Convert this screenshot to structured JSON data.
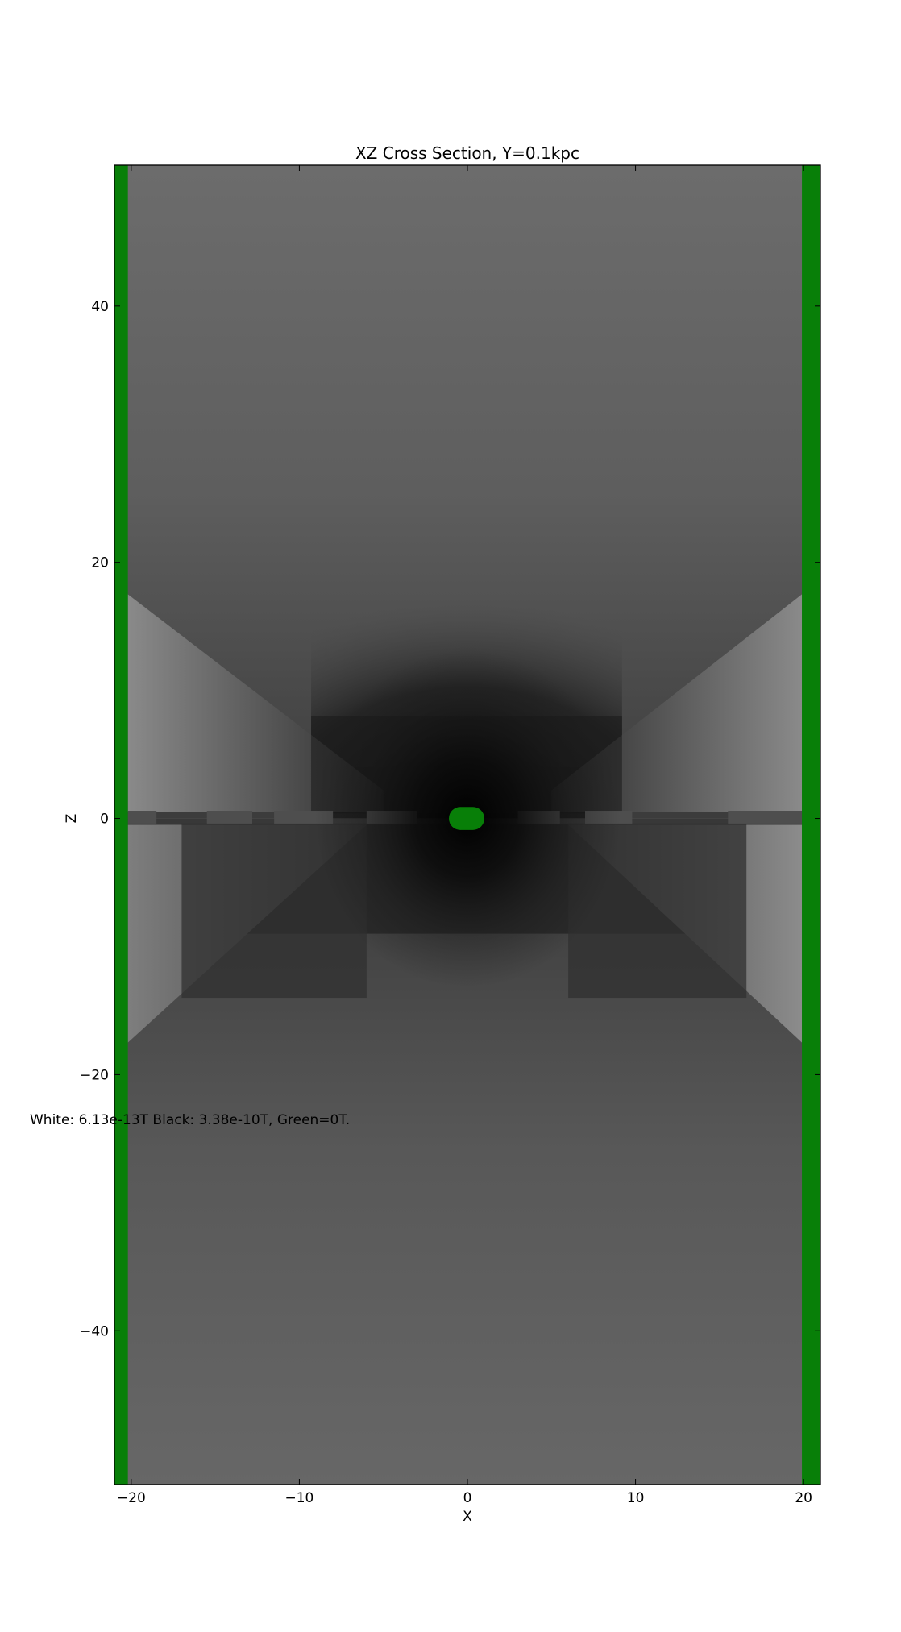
{
  "chart_data": {
    "type": "heatmap",
    "title": "XZ Cross Section, Y=0.1kpc",
    "xlabel": "X",
    "ylabel": "Z",
    "xlim": [
      -21,
      21
    ],
    "ylim": [
      -52,
      51
    ],
    "x_ticks": [
      -20,
      -10,
      0,
      10,
      20
    ],
    "x_tick_labels": [
      "−20",
      "−10",
      "0",
      "10",
      "20"
    ],
    "y_ticks": [
      40,
      20,
      0,
      -20,
      -40
    ],
    "y_tick_labels": [
      "40",
      "20",
      "0",
      "−20",
      "−40"
    ],
    "grid": false,
    "colormap": "gray",
    "mask_color": "#087f08",
    "annotation": "White: 6.13e-13T  Black: 3.38e-10T, Green=0T.",
    "zero_regions": [
      {
        "name": "left edge",
        "x_range": [
          -21,
          -20.2
        ],
        "z_range": [
          -52,
          51
        ]
      },
      {
        "name": "right edge",
        "x_range": [
          19.9,
          21
        ],
        "z_range": [
          -52,
          51
        ]
      },
      {
        "name": "center",
        "x_range": [
          -1.1,
          1.0
        ],
        "z_range": [
          -0.9,
          0.9
        ]
      }
    ]
  }
}
